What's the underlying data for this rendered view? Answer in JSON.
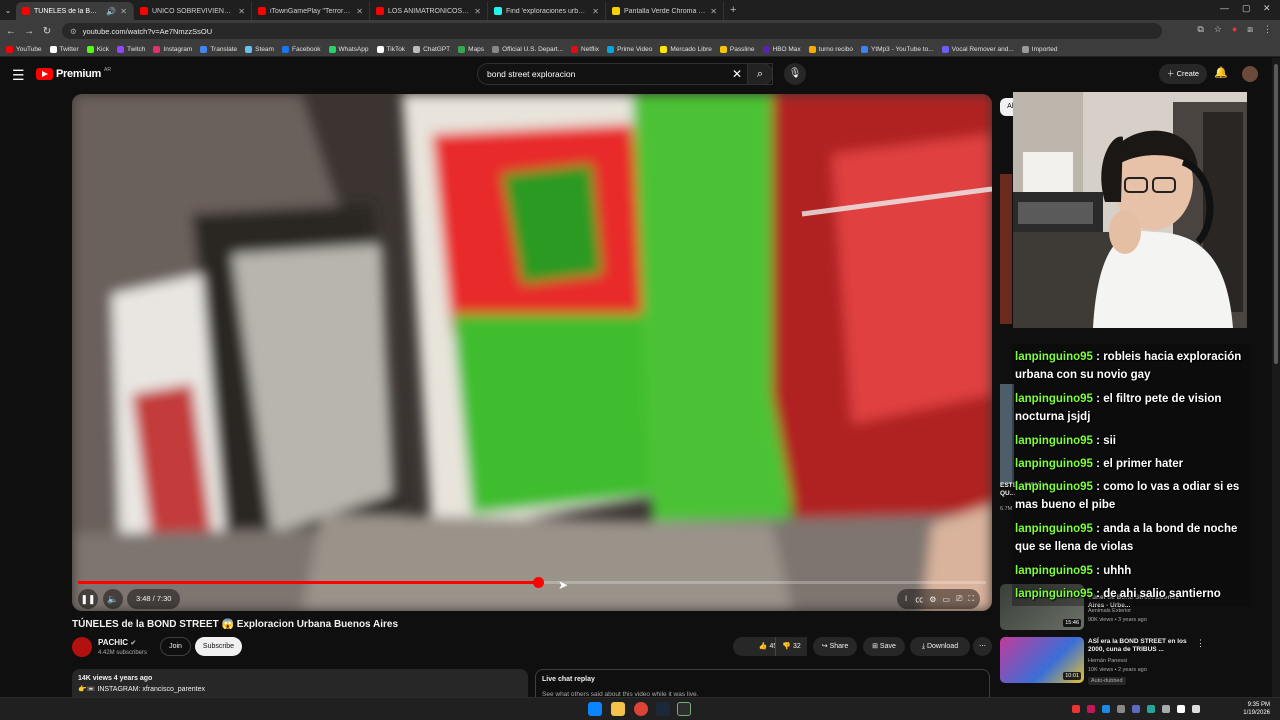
{
  "browser": {
    "tabs": [
      {
        "title": "TÚNELES de la BOND STRE",
        "active": true,
        "color": "#ff0000"
      },
      {
        "title": "UNICO SOBREVIVIENTE | ATRA",
        "active": false,
        "color": "#ff0000"
      },
      {
        "title": "iTownGamePlay \"Terror&Diver",
        "active": false,
        "color": "#ff0000"
      },
      {
        "title": "LOS ANIMATRÓNICOS WITHER",
        "active": false,
        "color": "#ff0000"
      },
      {
        "title": "Find 'exploraciones urbanas' on",
        "active": false,
        "color": "#25f4ee"
      },
      {
        "title": "Pantalla Verde Chroma | Merca",
        "active": false,
        "color": "#f5d300"
      }
    ],
    "url": "youtube.com/watch?v=Ae7NmzzSsOU",
    "bookmarks": [
      {
        "label": "YouTube",
        "color": "#ff0000"
      },
      {
        "label": "Twitter",
        "color": "#ffffff"
      },
      {
        "label": "Kick",
        "color": "#53fc18"
      },
      {
        "label": "Twitch",
        "color": "#9146ff"
      },
      {
        "label": "Instagram",
        "color": "#e1306c"
      },
      {
        "label": "Translate",
        "color": "#4285f4"
      },
      {
        "label": "Steam",
        "color": "#66c0f4"
      },
      {
        "label": "Facebook",
        "color": "#1877f2"
      },
      {
        "label": "WhatsApp",
        "color": "#25d366"
      },
      {
        "label": "TikTok",
        "color": "#ffffff"
      },
      {
        "label": "ChatGPT",
        "color": "#bbbbbb"
      },
      {
        "label": "Maps",
        "color": "#34a853"
      },
      {
        "label": "Official U.S. Depart...",
        "color": "#888888"
      },
      {
        "label": "Netflix",
        "color": "#e50914"
      },
      {
        "label": "Prime Video",
        "color": "#00a8e1"
      },
      {
        "label": "Mercado Libre",
        "color": "#ffe600"
      },
      {
        "label": "Passline",
        "color": "#f7c600"
      },
      {
        "label": "HBO Max",
        "color": "#5822b4"
      },
      {
        "label": "turno recibo",
        "color": "#f9ab00"
      },
      {
        "label": "YtMp3 - YouTube to...",
        "color": "#3b82f6"
      },
      {
        "label": "Vocal Remover and...",
        "color": "#6d5dfc"
      },
      {
        "label": "Imported",
        "color": "#999999"
      }
    ]
  },
  "youtube": {
    "logo": "Premium",
    "country": "AR",
    "search_query": "bond street exploracion",
    "create_label": "Create"
  },
  "video": {
    "time_label": "3:48 / 7:30",
    "progress": 0.507,
    "title": "TÚNELES de la BOND STREET 😱 Exploracion Urbana Buenos Aires",
    "channel": "PACHIC",
    "subscribers": "4.42M subscribers",
    "join_label": "Join",
    "subscribe_label": "Subscribe",
    "likes": "457",
    "dislikes": "32",
    "share_label": "Share",
    "save_label": "Save",
    "download_label": "Download",
    "views_meta": "14K views  4 years ago",
    "description": "👉📼 INSTAGRAM: xfrancisco_parentex",
    "livechat_title": "Live chat replay",
    "livechat_sub": "See what others said about this video while it was live."
  },
  "sidebar": {
    "chip": "All",
    "items": [
      {
        "title": "ESTE... PIENSA QU...",
        "meta": "6.7M",
        "duration": ""
      },
      {
        "title": "Túnel de Bond Street Buenos Aires - Urbe...",
        "channel": "Aenimals Exterior",
        "meta": "90K views • 3 years ago",
        "duration": "15:46"
      },
      {
        "title": "ASÍ era la BOND STREET en los 2000, cuna de TRIBUS ...",
        "channel": "Hernán Panessi",
        "meta": "10K views • 2 years ago",
        "duration": "10:01",
        "badge": "Auto-dubbed"
      }
    ]
  },
  "chat": [
    {
      "user": "lanpinguino95",
      "text": "robleis hacia exploración urbana con su novio gay"
    },
    {
      "user": "lanpinguino95",
      "text": "el filtro pete de vision nocturna jsjdj"
    },
    {
      "user": "lanpinguino95",
      "text": "sii"
    },
    {
      "user": "lanpinguino95",
      "text": "el primer hater"
    },
    {
      "user": "lanpinguino95",
      "text": "como lo vas a odiar si es mas bueno el pibe"
    },
    {
      "user": "lanpinguino95",
      "text": "anda a la bond de noche que se llena de violas"
    },
    {
      "user": "lanpinguino95",
      "text": "uhhh"
    },
    {
      "user": "lanpinguino95",
      "text": "de ahi salio santierno"
    }
  ],
  "taskbar": {
    "time": "9:35 PM",
    "date": "1/19/2026"
  }
}
